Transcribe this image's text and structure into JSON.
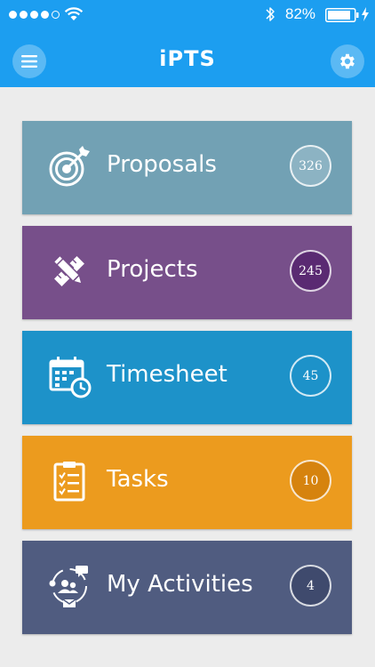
{
  "status_bar": {
    "battery_percent": "82%"
  },
  "header": {
    "title": "iPTS",
    "background": "#1c9ef0"
  },
  "tiles": [
    {
      "label": "Proposals",
      "count": "326",
      "color": "#72a1b4",
      "badge_fill": "#8cb3c3",
      "icon": "target-icon"
    },
    {
      "label": "Projects",
      "count": "245",
      "color": "#774f8a",
      "badge_fill": "#5a2a72",
      "icon": "pencil-ruler-icon"
    },
    {
      "label": "Timesheet",
      "count": "45",
      "color": "#1d92c9",
      "badge_fill": "#1d92c9",
      "icon": "calendar-clock-icon"
    },
    {
      "label": "Tasks",
      "count": "10",
      "color": "#ec9b1e",
      "badge_fill": "#d6830e",
      "icon": "clipboard-checklist-icon"
    },
    {
      "label": "My Activities",
      "count": "4",
      "color": "#505c80",
      "badge_fill": "#3f4a6d",
      "icon": "activity-people-icon"
    }
  ]
}
